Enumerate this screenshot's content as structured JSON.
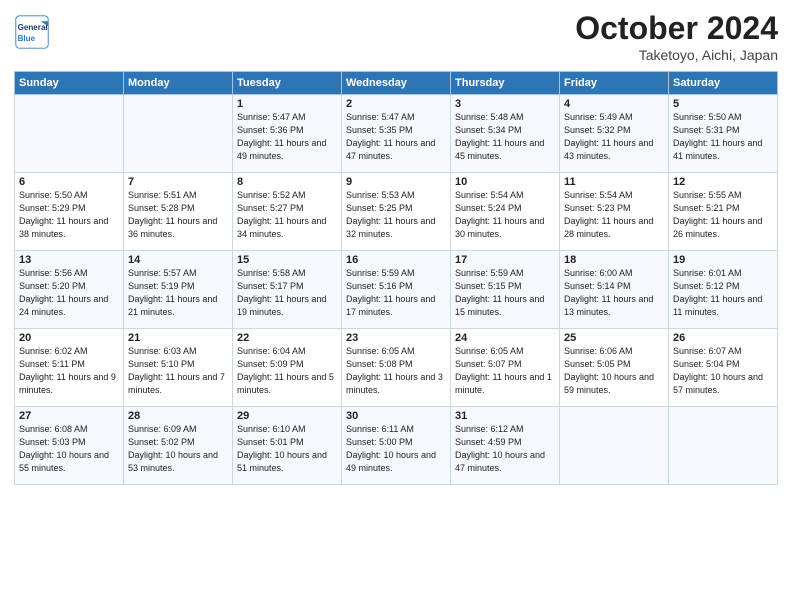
{
  "header": {
    "logo_general": "General",
    "logo_blue": "Blue",
    "month": "October 2024",
    "location": "Taketoyo, Aichi, Japan"
  },
  "weekdays": [
    "Sunday",
    "Monday",
    "Tuesday",
    "Wednesday",
    "Thursday",
    "Friday",
    "Saturday"
  ],
  "weeks": [
    [
      {
        "day": "",
        "info": ""
      },
      {
        "day": "",
        "info": ""
      },
      {
        "day": "1",
        "info": "Sunrise: 5:47 AM\nSunset: 5:36 PM\nDaylight: 11 hours and 49 minutes."
      },
      {
        "day": "2",
        "info": "Sunrise: 5:47 AM\nSunset: 5:35 PM\nDaylight: 11 hours and 47 minutes."
      },
      {
        "day": "3",
        "info": "Sunrise: 5:48 AM\nSunset: 5:34 PM\nDaylight: 11 hours and 45 minutes."
      },
      {
        "day": "4",
        "info": "Sunrise: 5:49 AM\nSunset: 5:32 PM\nDaylight: 11 hours and 43 minutes."
      },
      {
        "day": "5",
        "info": "Sunrise: 5:50 AM\nSunset: 5:31 PM\nDaylight: 11 hours and 41 minutes."
      }
    ],
    [
      {
        "day": "6",
        "info": "Sunrise: 5:50 AM\nSunset: 5:29 PM\nDaylight: 11 hours and 38 minutes."
      },
      {
        "day": "7",
        "info": "Sunrise: 5:51 AM\nSunset: 5:28 PM\nDaylight: 11 hours and 36 minutes."
      },
      {
        "day": "8",
        "info": "Sunrise: 5:52 AM\nSunset: 5:27 PM\nDaylight: 11 hours and 34 minutes."
      },
      {
        "day": "9",
        "info": "Sunrise: 5:53 AM\nSunset: 5:25 PM\nDaylight: 11 hours and 32 minutes."
      },
      {
        "day": "10",
        "info": "Sunrise: 5:54 AM\nSunset: 5:24 PM\nDaylight: 11 hours and 30 minutes."
      },
      {
        "day": "11",
        "info": "Sunrise: 5:54 AM\nSunset: 5:23 PM\nDaylight: 11 hours and 28 minutes."
      },
      {
        "day": "12",
        "info": "Sunrise: 5:55 AM\nSunset: 5:21 PM\nDaylight: 11 hours and 26 minutes."
      }
    ],
    [
      {
        "day": "13",
        "info": "Sunrise: 5:56 AM\nSunset: 5:20 PM\nDaylight: 11 hours and 24 minutes."
      },
      {
        "day": "14",
        "info": "Sunrise: 5:57 AM\nSunset: 5:19 PM\nDaylight: 11 hours and 21 minutes."
      },
      {
        "day": "15",
        "info": "Sunrise: 5:58 AM\nSunset: 5:17 PM\nDaylight: 11 hours and 19 minutes."
      },
      {
        "day": "16",
        "info": "Sunrise: 5:59 AM\nSunset: 5:16 PM\nDaylight: 11 hours and 17 minutes."
      },
      {
        "day": "17",
        "info": "Sunrise: 5:59 AM\nSunset: 5:15 PM\nDaylight: 11 hours and 15 minutes."
      },
      {
        "day": "18",
        "info": "Sunrise: 6:00 AM\nSunset: 5:14 PM\nDaylight: 11 hours and 13 minutes."
      },
      {
        "day": "19",
        "info": "Sunrise: 6:01 AM\nSunset: 5:12 PM\nDaylight: 11 hours and 11 minutes."
      }
    ],
    [
      {
        "day": "20",
        "info": "Sunrise: 6:02 AM\nSunset: 5:11 PM\nDaylight: 11 hours and 9 minutes."
      },
      {
        "day": "21",
        "info": "Sunrise: 6:03 AM\nSunset: 5:10 PM\nDaylight: 11 hours and 7 minutes."
      },
      {
        "day": "22",
        "info": "Sunrise: 6:04 AM\nSunset: 5:09 PM\nDaylight: 11 hours and 5 minutes."
      },
      {
        "day": "23",
        "info": "Sunrise: 6:05 AM\nSunset: 5:08 PM\nDaylight: 11 hours and 3 minutes."
      },
      {
        "day": "24",
        "info": "Sunrise: 6:05 AM\nSunset: 5:07 PM\nDaylight: 11 hours and 1 minute."
      },
      {
        "day": "25",
        "info": "Sunrise: 6:06 AM\nSunset: 5:05 PM\nDaylight: 10 hours and 59 minutes."
      },
      {
        "day": "26",
        "info": "Sunrise: 6:07 AM\nSunset: 5:04 PM\nDaylight: 10 hours and 57 minutes."
      }
    ],
    [
      {
        "day": "27",
        "info": "Sunrise: 6:08 AM\nSunset: 5:03 PM\nDaylight: 10 hours and 55 minutes."
      },
      {
        "day": "28",
        "info": "Sunrise: 6:09 AM\nSunset: 5:02 PM\nDaylight: 10 hours and 53 minutes."
      },
      {
        "day": "29",
        "info": "Sunrise: 6:10 AM\nSunset: 5:01 PM\nDaylight: 10 hours and 51 minutes."
      },
      {
        "day": "30",
        "info": "Sunrise: 6:11 AM\nSunset: 5:00 PM\nDaylight: 10 hours and 49 minutes."
      },
      {
        "day": "31",
        "info": "Sunrise: 6:12 AM\nSunset: 4:59 PM\nDaylight: 10 hours and 47 minutes."
      },
      {
        "day": "",
        "info": ""
      },
      {
        "day": "",
        "info": ""
      }
    ]
  ]
}
